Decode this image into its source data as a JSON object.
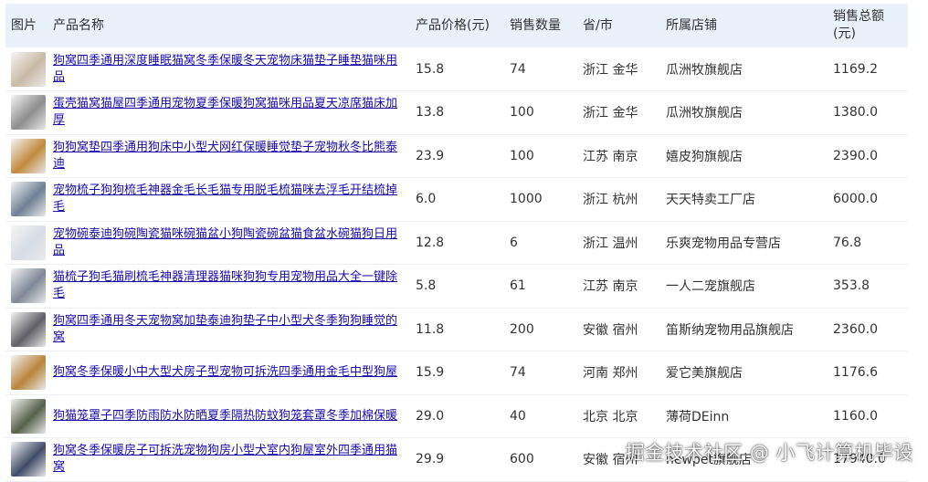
{
  "columns": [
    "图片",
    "产品名称",
    "产品价格(元)",
    "销售数量",
    "省/市",
    "所属店铺",
    "销售总额(元)"
  ],
  "rows": [
    {
      "name": "狗窝四季通用深度睡眠猫窝冬季保暖冬天宠物床猫垫子睡垫猫咪用品",
      "price": "15.8",
      "qty": "74",
      "loc": "浙江 金华",
      "shop": "瓜洲牧旗舰店",
      "total": "1169.2",
      "thumb": "#c9b9a6"
    },
    {
      "name": "蛋壳猫窝猫屋四季通用宠物夏季保暖狗窝猫咪用品夏天凉席猫床加厚",
      "price": "13.8",
      "qty": "100",
      "loc": "浙江 金华",
      "shop": "瓜洲牧旗舰店",
      "total": "1380.0",
      "thumb": "#8d8d8d"
    },
    {
      "name": "狗狗窝垫四季通用狗床中小型犬网红保暖睡觉垫子宠物秋冬比熊泰迪",
      "price": "23.9",
      "qty": "100",
      "loc": "江苏 南京",
      "shop": "嬉皮狗旗舰店",
      "total": "2390.0",
      "thumb": "#c08a3e"
    },
    {
      "name": "宠物梳子狗狗梳毛神器金毛长毛猫专用脱毛梳猫咪去浮毛开结梳掉毛",
      "price": "6.0",
      "qty": "1000",
      "loc": "浙江 杭州",
      "shop": "天天特卖工厂店",
      "total": "6000.0",
      "thumb": "#6f7f95"
    },
    {
      "name": "宠物碗泰迪狗碗陶瓷猫咪碗猫盆小狗陶瓷碗盆猫食盆水碗猫狗日用品",
      "price": "12.8",
      "qty": "6",
      "loc": "浙江 温州",
      "shop": "乐爽宠物用品专营店",
      "total": "76.8",
      "thumb": "#d7dde6"
    },
    {
      "name": "猫梳子狗毛猫刷梳毛神器清理器猫咪狗狗专用宠物用品大全一键除毛",
      "price": "5.8",
      "qty": "61",
      "loc": "江苏 南京",
      "shop": "一人二宠旗舰店",
      "total": "353.8",
      "thumb": "#7e8896"
    },
    {
      "name": "狗窝四季通用冬天宠物窝加垫泰迪狗垫子中小型犬冬季狗狗睡觉的窝",
      "price": "11.8",
      "qty": "200",
      "loc": "安徽 宿州",
      "shop": "笛斯纳宠物用品旗舰店",
      "total": "2360.0",
      "thumb": "#5f5f66"
    },
    {
      "name": "狗窝冬季保暖小中大型犬房子型宠物可拆洗四季通用金毛中型狗屋",
      "price": "15.9",
      "qty": "74",
      "loc": "河南 郑州",
      "shop": "爱它美旗舰店",
      "total": "1176.6",
      "thumb": "#b7843a"
    },
    {
      "name": "狗猫笼罩子四季防雨防水防晒夏季隔热防蚊狗笼套罩冬季加棉保暖",
      "price": "29.0",
      "qty": "40",
      "loc": "北京 北京",
      "shop": "薄荷DEinn",
      "total": "1160.0",
      "thumb": "#55604a"
    },
    {
      "name": "狗窝冬季保暖房子可拆洗宠物狗房小型犬室内狗屋室外四季通用猫窝",
      "price": "29.9",
      "qty": "600",
      "loc": "安徽 宿州",
      "shop": "newpet旗舰店",
      "total": "17940.0",
      "thumb": "#3f4a66"
    }
  ],
  "watermark": "掘金技术社区 @ 小飞计算机毕设"
}
